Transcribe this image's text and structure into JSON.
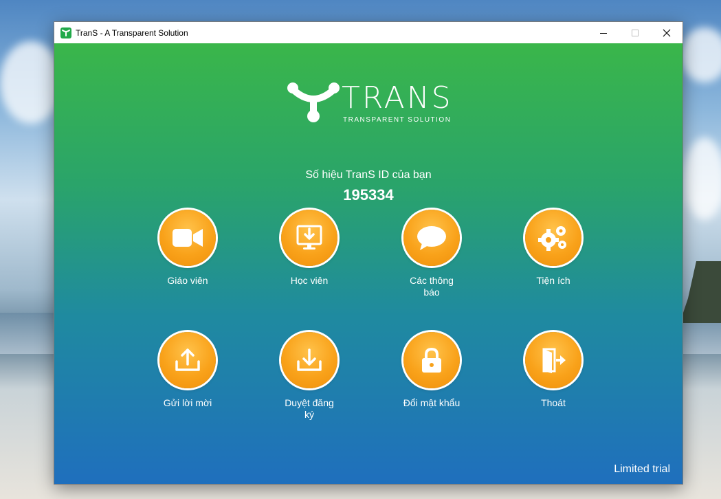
{
  "window": {
    "title": "TranS - A Transparent Solution"
  },
  "logo": {
    "word": "TRANS",
    "tagline": "TRANSPARENT SOLUTION"
  },
  "id_panel": {
    "label": "Số hiệu TranS ID của bạn",
    "value": "195334"
  },
  "tiles": [
    {
      "label": "Giáo viên",
      "icon": "video-camera-icon"
    },
    {
      "label": "Học viên",
      "icon": "monitor-download-icon"
    },
    {
      "label": "Các thông báo",
      "icon": "chat-bubble-icon"
    },
    {
      "label": "Tiện ích",
      "icon": "gears-icon"
    },
    {
      "label": "Gửi lời mời",
      "icon": "upload-icon"
    },
    {
      "label": "Duyệt đăng ký",
      "icon": "download-icon"
    },
    {
      "label": "Đổi mật khẩu",
      "icon": "lock-icon"
    },
    {
      "label": "Thoát",
      "icon": "exit-door-icon"
    }
  ],
  "status": {
    "license": "Limited trial"
  },
  "colors": {
    "accent_orange": "#f9a21a",
    "gradient_top": "#3ab64a",
    "gradient_bottom": "#1f6fbd"
  }
}
